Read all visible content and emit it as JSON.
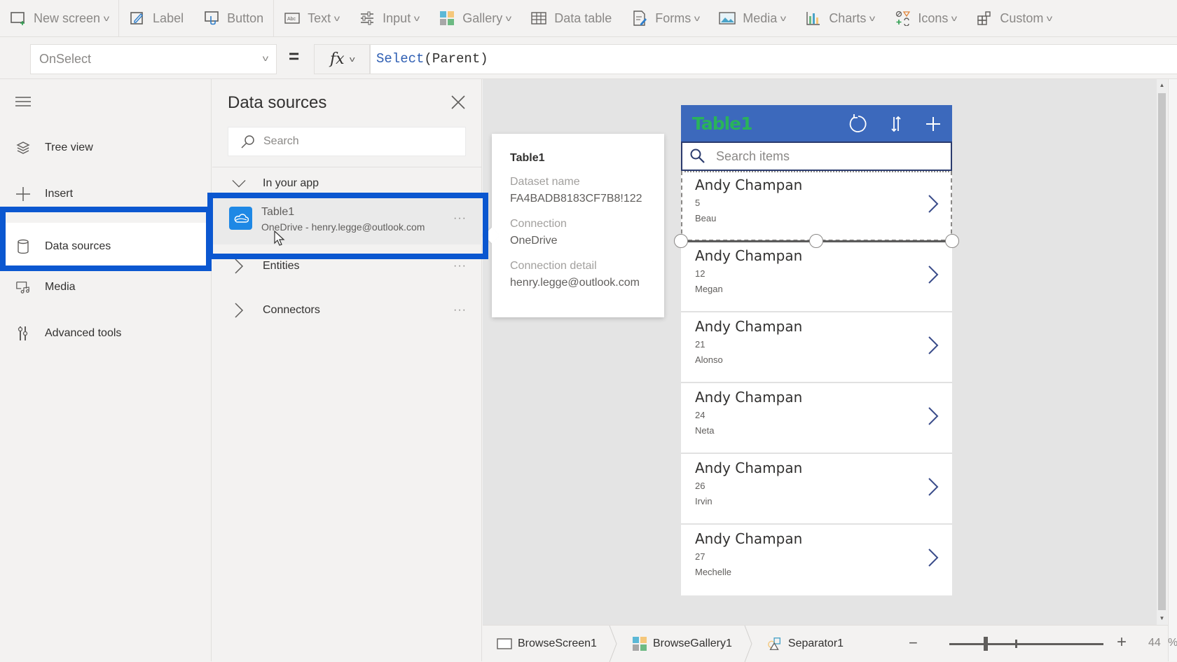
{
  "toolbar": {
    "items": [
      {
        "label": "New screen",
        "icon": "new-screen-icon",
        "dropdown": true
      },
      {
        "label": "Label",
        "icon": "label-icon",
        "dropdown": false
      },
      {
        "label": "Button",
        "icon": "button-icon",
        "dropdown": false
      },
      {
        "label": "Text",
        "icon": "text-icon",
        "dropdown": true
      },
      {
        "label": "Input",
        "icon": "input-icon",
        "dropdown": true
      },
      {
        "label": "Gallery",
        "icon": "gallery-icon",
        "dropdown": true
      },
      {
        "label": "Data table",
        "icon": "data-table-icon",
        "dropdown": false
      },
      {
        "label": "Forms",
        "icon": "forms-icon",
        "dropdown": true
      },
      {
        "label": "Media",
        "icon": "media-icon",
        "dropdown": true
      },
      {
        "label": "Charts",
        "icon": "charts-icon",
        "dropdown": true
      },
      {
        "label": "Icons",
        "icon": "icons-icon",
        "dropdown": true
      },
      {
        "label": "Custom",
        "icon": "custom-icon",
        "dropdown": true
      }
    ]
  },
  "formula_bar": {
    "property": "OnSelect",
    "equals": "=",
    "fx_label": "fx",
    "formula_function": "Select",
    "formula_args": "(Parent)"
  },
  "left_nav": {
    "items": [
      {
        "label": "Tree view",
        "icon": "layers-icon"
      },
      {
        "label": "Insert",
        "icon": "plus-icon"
      },
      {
        "label": "Data sources",
        "icon": "database-icon",
        "active": true
      },
      {
        "label": "Media",
        "icon": "media-icon"
      },
      {
        "label": "Advanced tools",
        "icon": "tools-icon"
      }
    ]
  },
  "data_sources": {
    "title": "Data sources",
    "search_placeholder": "Search",
    "groups": {
      "in_your_app": "In your app",
      "entities": "Entities",
      "connectors": "Connectors"
    },
    "more": "···",
    "table1": {
      "name": "Table1",
      "subtitle": "OneDrive - henry.legge@outlook.com"
    }
  },
  "callout": {
    "title": "Table1",
    "dataset_label": "Dataset name",
    "dataset_value": "FA4BADB8183CF7B8!122",
    "connection_label": "Connection",
    "connection_value": "OneDrive",
    "detail_label": "Connection detail",
    "detail_value": "henry.legge@outlook.com"
  },
  "app_preview": {
    "title": "Table1",
    "search_placeholder": "Search items",
    "colors": {
      "header": "#3c69bc",
      "title": "#29b35b",
      "highlight": "#0b57d0"
    },
    "rows": [
      {
        "name": "Andy Champan",
        "age": "5",
        "first": "Beau"
      },
      {
        "name": "Andy Champan",
        "age": "12",
        "first": "Megan"
      },
      {
        "name": "Andy Champan",
        "age": "21",
        "first": "Alonso"
      },
      {
        "name": "Andy Champan",
        "age": "24",
        "first": "Neta"
      },
      {
        "name": "Andy Champan",
        "age": "26",
        "first": "Irvin"
      },
      {
        "name": "Andy Champan",
        "age": "27",
        "first": "Mechelle"
      }
    ]
  },
  "bottom_bar": {
    "breadcrumbs": [
      {
        "label": "BrowseScreen1",
        "icon": "screen-icon"
      },
      {
        "label": "BrowseGallery1",
        "icon": "gallery-icon"
      },
      {
        "label": "Separator1",
        "icon": "shapes-icon"
      }
    ],
    "zoom_minus": "−",
    "zoom_plus": "+",
    "zoom_value": "44",
    "zoom_unit": "%"
  }
}
